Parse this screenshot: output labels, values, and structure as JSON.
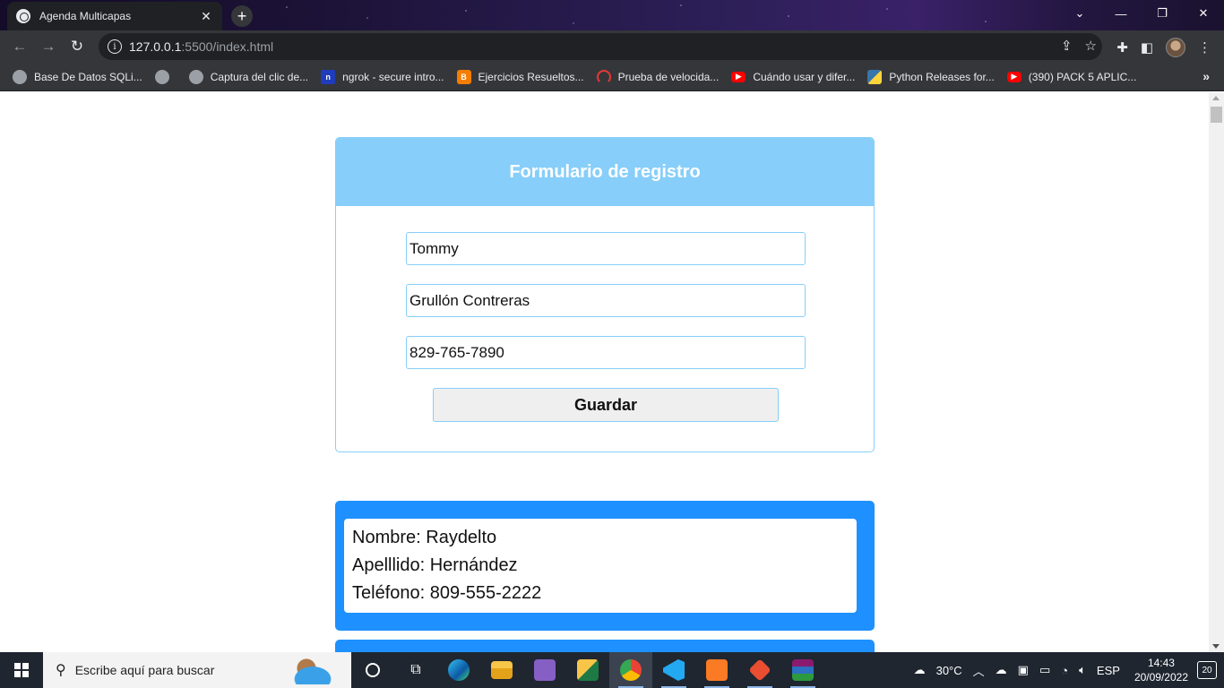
{
  "browser": {
    "tab_title": "Agenda Multicapas",
    "url_host": "127.0.0.1",
    "url_path": ":5500/index.html"
  },
  "bookmarks": [
    {
      "label": "Base De Datos SQLi...",
      "icon": "globe-icon"
    },
    {
      "label": "",
      "icon": "globe-icon"
    },
    {
      "label": "Captura del clic de...",
      "icon": "globe-icon"
    },
    {
      "label": "ngrok - secure intro...",
      "icon": "ngrok-icon"
    },
    {
      "label": "Ejercicios Resueltos...",
      "icon": "blogger-icon"
    },
    {
      "label": "Prueba de velocida...",
      "icon": "speedtest-icon"
    },
    {
      "label": "Cuándo usar y difer...",
      "icon": "youtube-icon"
    },
    {
      "label": "Python Releases for...",
      "icon": "python-icon"
    },
    {
      "label": "(390) PACK 5 APLIC...",
      "icon": "youtube-icon"
    }
  ],
  "form": {
    "title": "Formulario de registro",
    "nombre_value": "Tommy",
    "apellido_value": "Grullón Contreras",
    "telefono_value": "829-765-7890",
    "save_label": "Guardar"
  },
  "contacts": [
    {
      "nombre": "Nombre: Raydelto",
      "apellido": "Apelllido: Hernández",
      "telefono": "Teléfono: 809-555-2222"
    }
  ],
  "taskbar": {
    "search_placeholder": "Escribe aquí para buscar",
    "weather": "30°C",
    "language": "ESP",
    "time": "14:43",
    "date": "20/09/2022",
    "notifications": "20"
  },
  "colors": {
    "form_accent": "#87cefa",
    "card_bg": "#1e90ff"
  }
}
